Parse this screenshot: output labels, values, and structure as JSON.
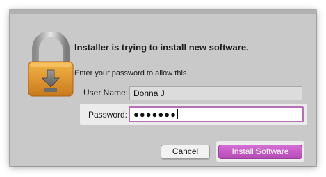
{
  "dialog": {
    "title": "Installer is trying to install new software.",
    "subtitle": "Enter your password to allow this.",
    "icon": "lock-icon"
  },
  "fields": {
    "username_label": "User Name:",
    "username_value": "Donna J",
    "password_label": "Password:",
    "password_value": "●●●●●●●"
  },
  "buttons": {
    "cancel": "Cancel",
    "install": "Install Software"
  },
  "colors": {
    "accent": "#b34cb4",
    "focus_ring": "#b46fb5",
    "lock_body": "#e8a238"
  }
}
